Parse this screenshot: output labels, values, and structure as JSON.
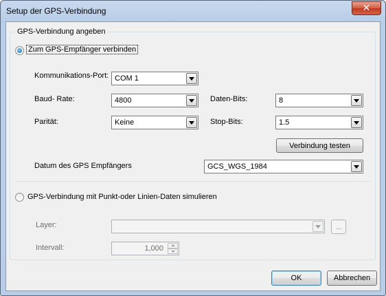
{
  "window": {
    "title": "Setup der GPS-Verbindung",
    "close_glyph": "✕"
  },
  "group": {
    "legend": "GPS-Verbindung angeben"
  },
  "connect_option": {
    "label": "Zum GPS-Empfänger verbinden",
    "checked": true
  },
  "fields": {
    "port": {
      "label": "Kommunikations-Port:",
      "value": "COM 1"
    },
    "baud": {
      "label": "Baud- Rate:",
      "value": "4800"
    },
    "parity": {
      "label": "Parität:",
      "value": "Keine"
    },
    "databits": {
      "label": "Daten-Bits:",
      "value": "8"
    },
    "stopbits": {
      "label": "Stop-Bits:",
      "value": "1.5"
    },
    "test_button": "Verbindung testen",
    "datum": {
      "label": "Datum des GPS Empfängers",
      "value": "GCS_WGS_1984"
    }
  },
  "simulate_option": {
    "label": "GPS-Verbindung  mit  Punkt-oder  Linien-Daten  simulieren",
    "checked": false
  },
  "simulate": {
    "layer_label": "Layer:",
    "layer_value": "",
    "browse_label": "...",
    "interval_label": "Intervall:",
    "interval_value": "1,000"
  },
  "footer": {
    "ok": "OK",
    "cancel": "Abbrechen"
  }
}
